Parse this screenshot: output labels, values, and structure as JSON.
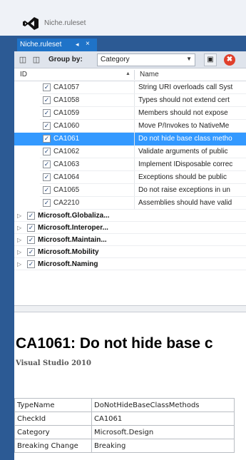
{
  "window": {
    "title": "Niche.ruleset",
    "tab_label": "Niche.ruleset",
    "tab_pin": "◂",
    "tab_close": "×"
  },
  "toolbar": {
    "group_by_label": "Group by:",
    "group_by_value": "Category"
  },
  "columns": {
    "id": "ID",
    "name": "Name"
  },
  "rules": [
    {
      "id": "CA1057",
      "name": "String URI overloads call Syst",
      "checked": true
    },
    {
      "id": "CA1058",
      "name": "Types should not extend cert",
      "checked": true
    },
    {
      "id": "CA1059",
      "name": "Members should not expose",
      "checked": true
    },
    {
      "id": "CA1060",
      "name": "Move P/Invokes to NativeMe",
      "checked": true
    },
    {
      "id": "CA1061",
      "name": "Do not hide base class metho",
      "checked": true,
      "selected": true
    },
    {
      "id": "CA1062",
      "name": "Validate arguments of public",
      "checked": true
    },
    {
      "id": "CA1063",
      "name": "Implement IDisposable correc",
      "checked": true
    },
    {
      "id": "CA1064",
      "name": "Exceptions should be public",
      "checked": true
    },
    {
      "id": "CA1065",
      "name": "Do not raise exceptions in un",
      "checked": true
    },
    {
      "id": "CA2210",
      "name": "Assemblies should have valid",
      "checked": true
    }
  ],
  "groups": [
    {
      "name": "Microsoft.Globaliza..."
    },
    {
      "name": "Microsoft.Interoper..."
    },
    {
      "name": "Microsoft.Maintain..."
    },
    {
      "name": "Microsoft.Mobility"
    },
    {
      "name": "Microsoft.Naming"
    }
  ],
  "details": {
    "title": "CA1061: Do not hide base c",
    "subtitle": "Visual Studio 2010",
    "properties": [
      {
        "key": "TypeName",
        "value": "DoNotHideBaseClassMethods"
      },
      {
        "key": "CheckId",
        "value": "CA1061"
      },
      {
        "key": "Category",
        "value": "Microsoft.Design"
      },
      {
        "key": "Breaking Change",
        "value": "Breaking"
      }
    ]
  },
  "colors": {
    "chrome_blue": "#2c5a94",
    "selection": "#3399ff",
    "error_red": "#e0402c"
  }
}
